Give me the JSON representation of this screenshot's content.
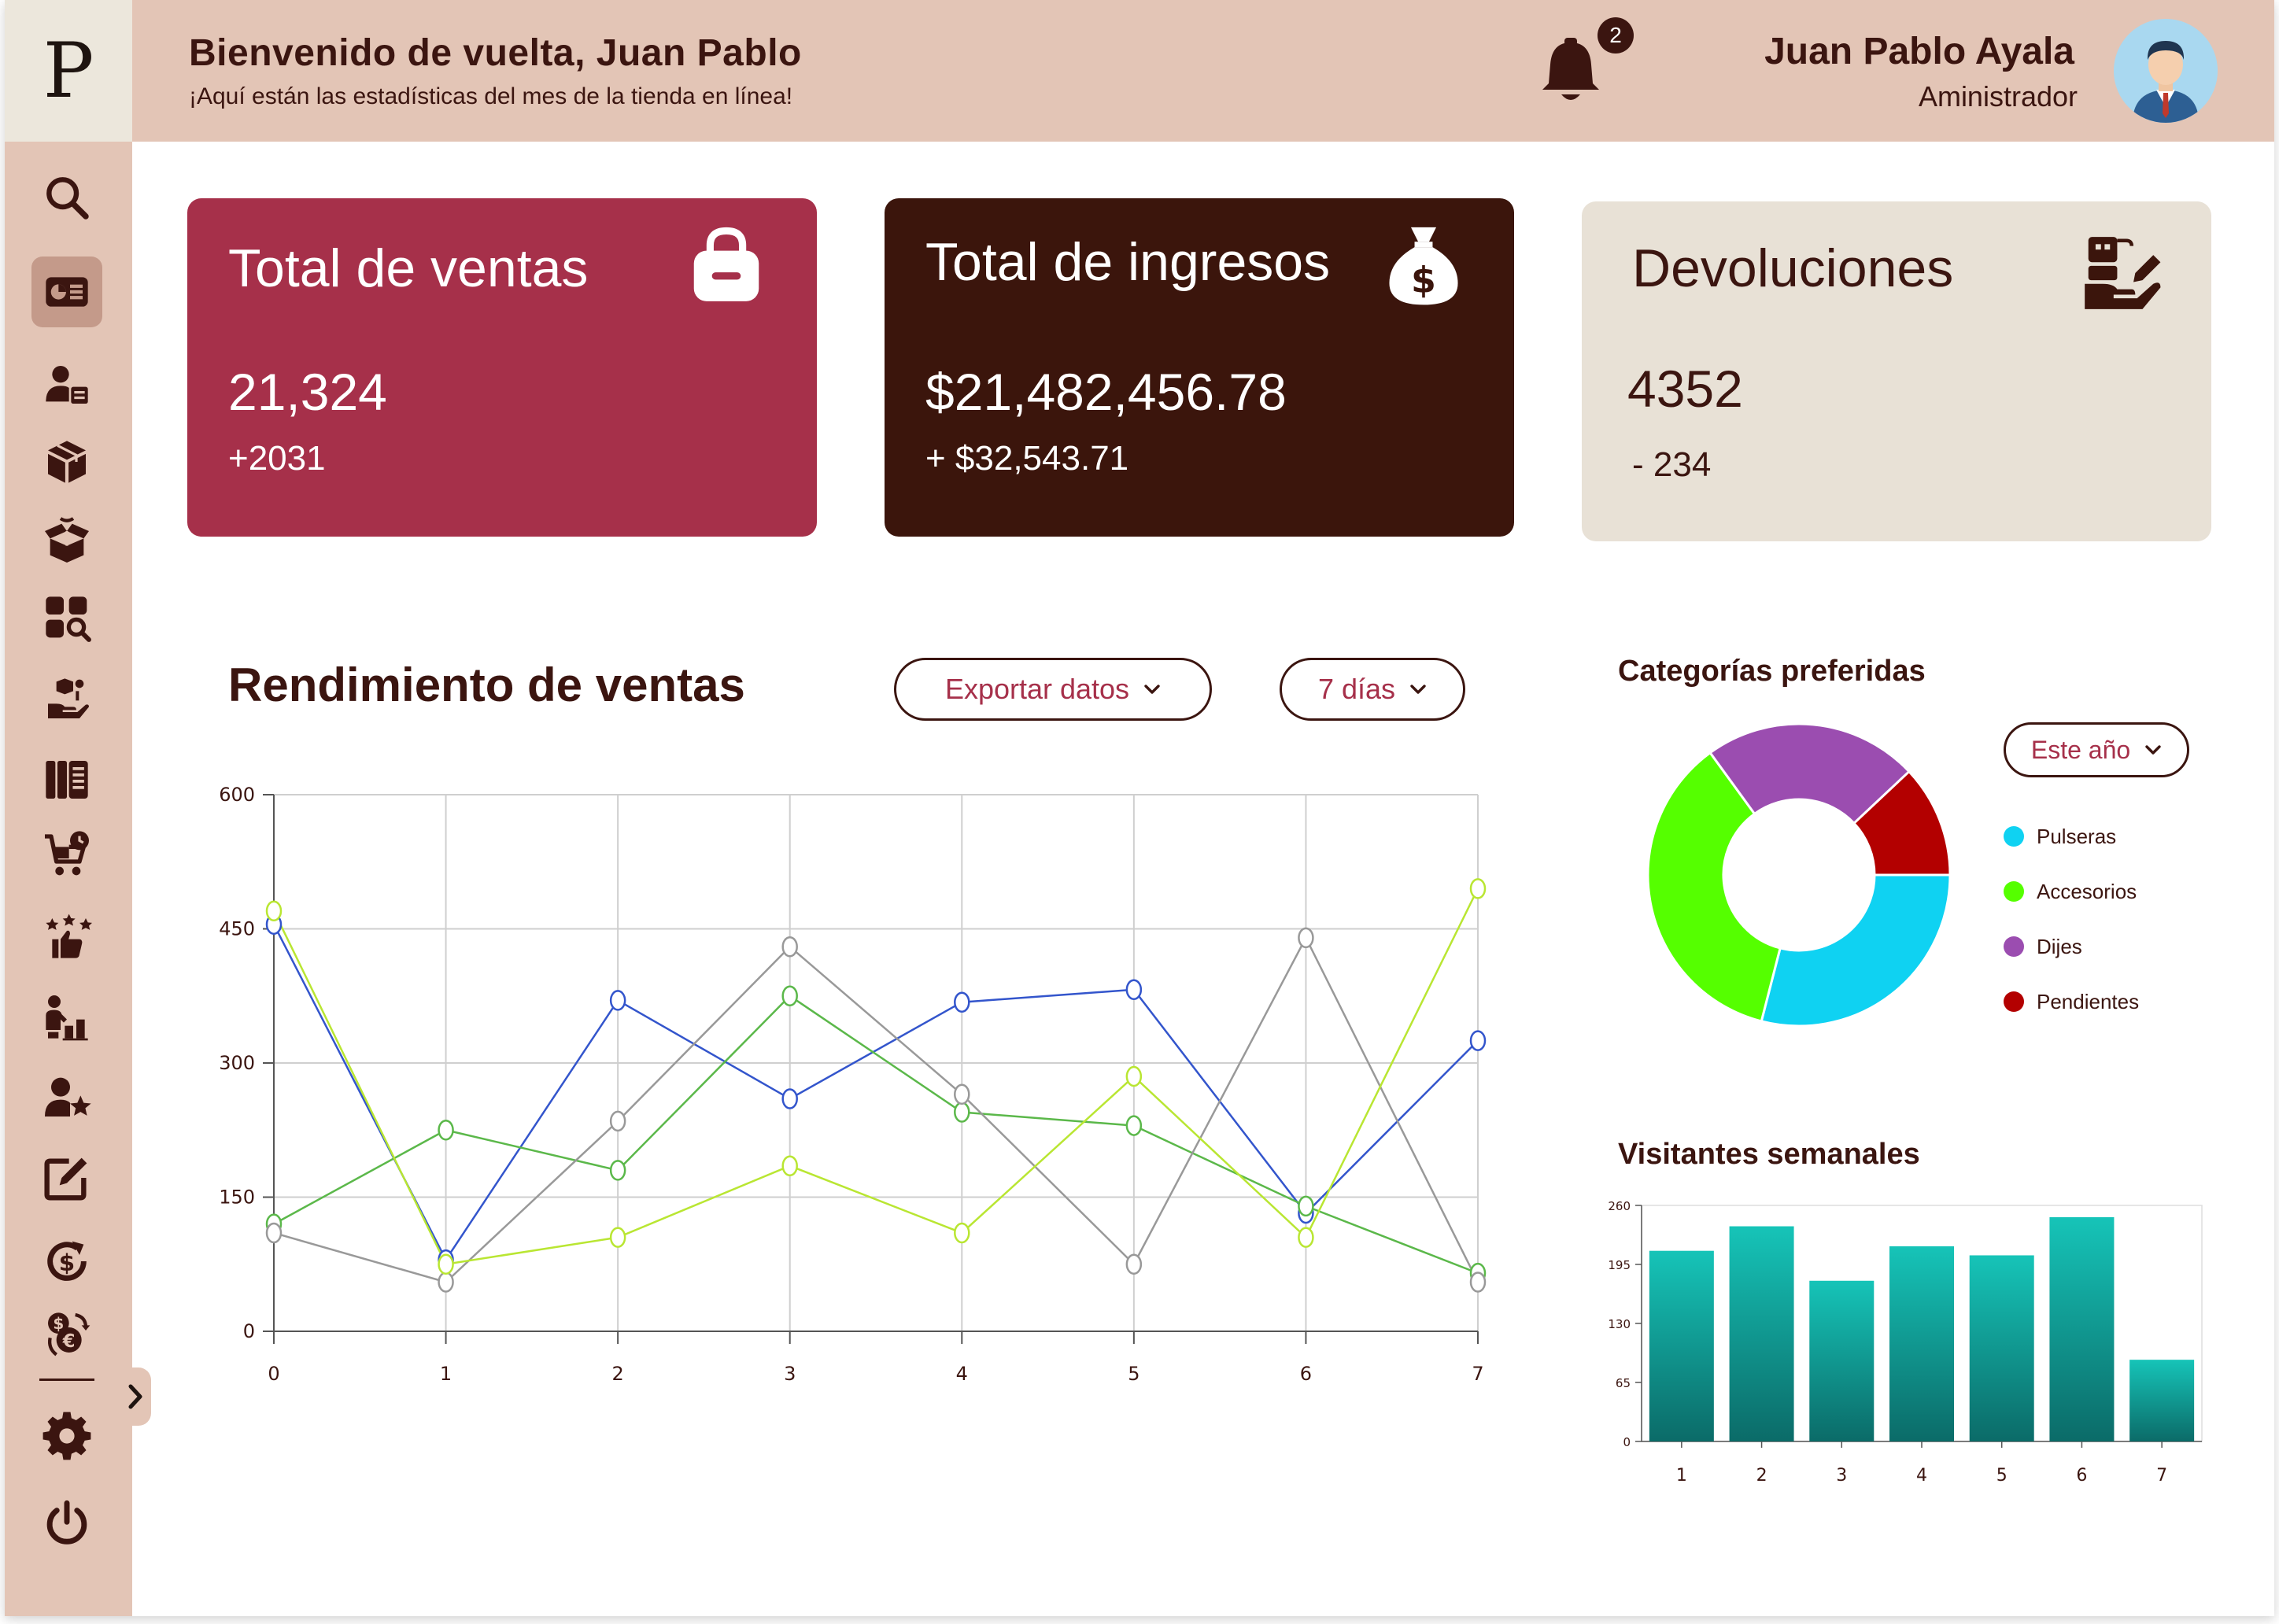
{
  "logo": "P",
  "header": {
    "welcome_title": "Bienvenido de vuelta, Juan Pablo",
    "welcome_subtitle": "¡Aquí están las estadísticas del mes de la tienda en línea!",
    "notification_count": "2",
    "user_name": "Juan Pablo Ayala",
    "user_role": "Aministrador"
  },
  "sidebar": {
    "items": [
      {
        "icon": "search-icon"
      },
      {
        "icon": "dashboard-icon",
        "active": true
      },
      {
        "icon": "user-id-icon"
      },
      {
        "icon": "box-icon"
      },
      {
        "icon": "open-box-icon"
      },
      {
        "icon": "category-search-icon"
      },
      {
        "icon": "hand-delivery-icon"
      },
      {
        "icon": "catalog-icon"
      },
      {
        "icon": "cart-clock-icon"
      },
      {
        "icon": "rating-thumb-icon"
      },
      {
        "icon": "user-stats-icon"
      },
      {
        "icon": "user-star-icon"
      },
      {
        "icon": "edit-note-icon"
      },
      {
        "icon": "dollar-refresh-icon"
      },
      {
        "icon": "euro-exchange-icon"
      },
      {
        "icon": "gear-icon"
      },
      {
        "icon": "power-icon"
      }
    ]
  },
  "cards": {
    "sales": {
      "title": "Total de ventas",
      "value": "21,324",
      "delta": "+2031",
      "icon": "shopping-bag-icon"
    },
    "income": {
      "title": "Total de ingresos",
      "value": "$21,482,456.78",
      "delta": "+ $32,543.71",
      "icon": "money-bag-icon"
    },
    "returns": {
      "title": "Devoluciones",
      "value": "4352",
      "delta": "- 234",
      "icon": "return-box-icon"
    }
  },
  "performance": {
    "title": "Rendimiento de ventas",
    "export_label": "Exportar datos",
    "range_label": "7 días"
  },
  "categories": {
    "title": "Categorías preferidas",
    "range_label": "Este año"
  },
  "visitors": {
    "title": "Visitantes semanales"
  },
  "colors": {
    "accent": "#a6304a",
    "dark": "#3b150c",
    "beige": "#e8e1d6",
    "header": "#e3c5b6"
  },
  "chart_data": [
    {
      "type": "line",
      "x": [
        0,
        1,
        2,
        3,
        4,
        5,
        6,
        7
      ],
      "ylim": [
        0,
        600
      ],
      "yticks": [
        0,
        150,
        300,
        450,
        600
      ],
      "grid": true,
      "series": [
        {
          "color": "#3355cc",
          "values": [
            455,
            80,
            370,
            260,
            368,
            382,
            132,
            325
          ]
        },
        {
          "color": "#5bb84a",
          "values": [
            120,
            225,
            180,
            375,
            245,
            230,
            140,
            65
          ]
        },
        {
          "color": "#999999",
          "values": [
            110,
            55,
            235,
            430,
            265,
            75,
            440,
            55
          ]
        },
        {
          "color": "#b9e632",
          "values": [
            470,
            75,
            105,
            185,
            110,
            285,
            105,
            495
          ]
        }
      ]
    },
    {
      "type": "pie",
      "donut": true,
      "slices": [
        {
          "label": "Pulseras",
          "value": 29,
          "color": "#0fd2f2"
        },
        {
          "label": "Accesorios",
          "value": 36,
          "color": "#55ff00"
        },
        {
          "label": "Dijes",
          "value": 23,
          "color": "#9b4db0"
        },
        {
          "label": "Pendientes",
          "value": 12,
          "color": "#b30000"
        }
      ],
      "legend": "right"
    },
    {
      "type": "bar",
      "categories": [
        "1",
        "2",
        "3",
        "4",
        "5",
        "6",
        "7"
      ],
      "values": [
        210,
        237,
        177,
        215,
        205,
        247,
        90
      ],
      "ylim": [
        0,
        260
      ],
      "yticks": [
        0,
        65,
        130,
        195,
        260
      ],
      "color_top": "#16c4b8",
      "color_bottom": "#0b6b68"
    }
  ]
}
